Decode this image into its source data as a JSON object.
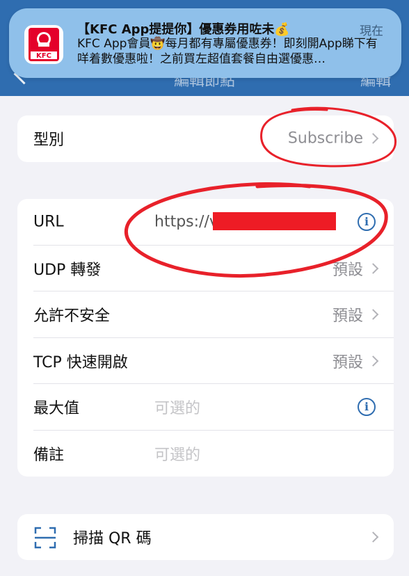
{
  "navbar": {
    "title": "編輯節點",
    "right": "編輯"
  },
  "notification": {
    "title": "【KFC App提提你】優惠券用咗未💰",
    "body": "KFC App會員🤠每月都有專屬優惠券！即刻開App睇下有咩着數優惠啦！之前買左超值套餐自由選優惠…",
    "time": "現在",
    "logo_text": "KFC"
  },
  "type_row": {
    "label": "型別",
    "value": "Subscribe"
  },
  "settings": {
    "url": {
      "label": "URL",
      "value": "https://v"
    },
    "udp": {
      "label": "UDP 轉發",
      "value": "預設"
    },
    "insecure": {
      "label": "允許不安全",
      "value": "預設"
    },
    "tcp": {
      "label": "TCP 快速開啟",
      "value": "預設"
    },
    "max": {
      "label": "最大值",
      "placeholder": "可選的"
    },
    "remark": {
      "label": "備註",
      "placeholder": "可選的"
    }
  },
  "scan": {
    "label": "掃描 QR 碼"
  },
  "colors": {
    "accent": "#2f6db0",
    "annotation": "#e8212a",
    "redaction": "#ee1c25"
  }
}
